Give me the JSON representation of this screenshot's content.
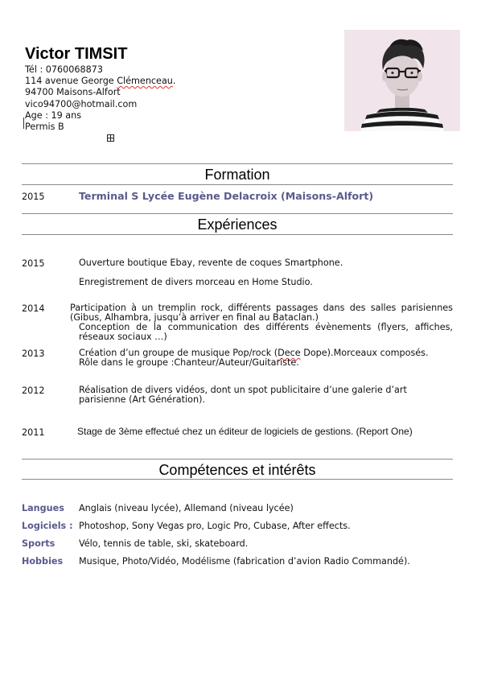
{
  "header": {
    "name": "Victor TIMSIT",
    "phone": "Tél : 0760068873",
    "address_prefix": "114 avenue George ",
    "address_spellword": "Clémenceau",
    "address_suffix": ".",
    "city": "94700 Maisons-Alfort",
    "email": "vico94700@hotmail.com",
    "age": "Age : 19 ans",
    "license": "Permis B"
  },
  "sections": {
    "formation": "Formation",
    "experiences": "Expériences",
    "competences": "Compétences et intérêts"
  },
  "formation": {
    "year": "2015",
    "entry": "Terminal S Lycée Eugène Delacroix (Maisons-Alfort)"
  },
  "experiences": [
    {
      "year": "2015",
      "lines": [
        "Ouverture boutique Ebay, revente de coques Smartphone.",
        "Enregistrement de divers morceau en Home Studio."
      ]
    },
    {
      "year": "2014",
      "lines": [
        "Participation à un tremplin rock, différents passages dans des salles parisiennes (Gibus, Alhambra, jusqu’à arriver en final au Bataclan.)",
        "Conception de la communication des différents évènements (flyers, affiches, réseaux sociaux …)"
      ]
    },
    {
      "year": "2013",
      "line1_prefix": "Création d’un groupe de musique Pop/rock (",
      "line1_spell": "Dece",
      "line1_suffix": " Dope).Morceaux composés.",
      "line2": "Rôle dans le groupe :Chanteur/Auteur/Guitariste."
    },
    {
      "year": "2012",
      "lines": [
        "Réalisation de divers vidéos, dont un spot publicitaire d’une galerie d’art parisienne (Art Génération)."
      ]
    },
    {
      "year": "2011",
      "lines": [
        "Stage de 3ème effectué chez un éditeur de logiciels de gestions. (Report One)"
      ]
    }
  ],
  "skills": [
    {
      "label": "Langues",
      "value": "Anglais (niveau lycée), Allemand (niveau lycée)"
    },
    {
      "label": "Logiciels :",
      "value": "Photoshop, Sony Vegas pro, Logic Pro, Cubase, After effects."
    },
    {
      "label": "Sports",
      "value": "Vélo, tennis de table, ski, skateboard."
    },
    {
      "label": "Hobbies",
      "value": "Musique, Photo/Vidéo, Modélisme (fabrication d’avion Radio Commandé)."
    }
  ],
  "colors": {
    "accent": "#5a5a8e",
    "rule": "#8a8a8a",
    "spell_underline": "#d33333"
  },
  "icons": {
    "photo": "portrait-photo",
    "resize": "resize-handle-icon"
  }
}
